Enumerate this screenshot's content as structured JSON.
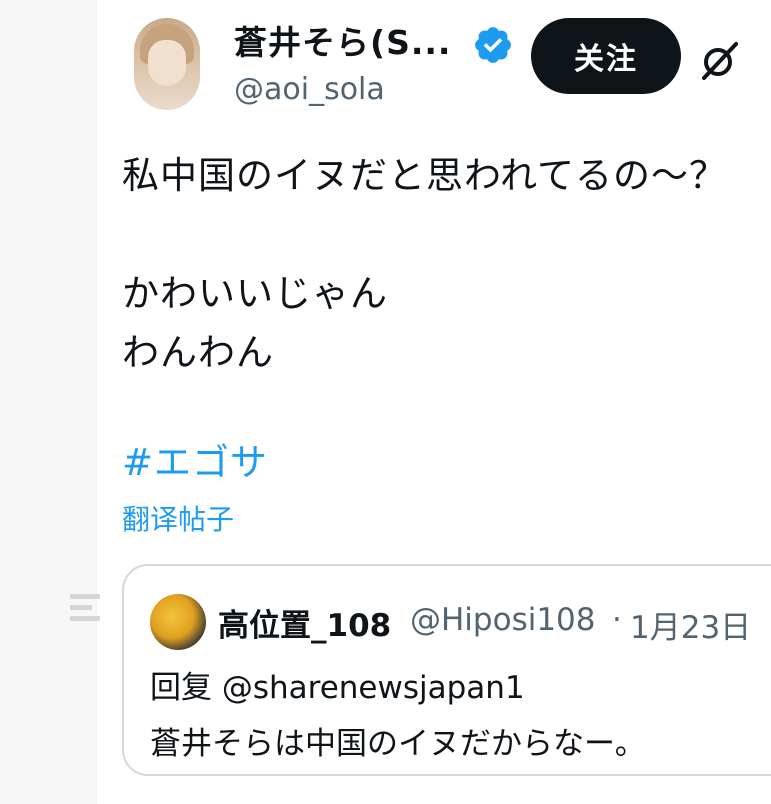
{
  "author": {
    "display_name": "蒼井そら(S...",
    "handle": "@aoi_sola",
    "verified": true
  },
  "header": {
    "follow_label": "关注"
  },
  "post": {
    "text": "私中国のイヌだと思われてるの～？\n\nかわいいじゃん\nわんわん",
    "hashtag": "#エゴサ",
    "translate_label": "翻译帖子"
  },
  "quoted_post": {
    "display_name": "高位置_108",
    "handle": "@Hiposi108",
    "separator": "·",
    "date": "1月23日",
    "reply_to": "回复 @sharenewsjapan1",
    "text": "蒼井そらは中国のイヌだからなー。"
  },
  "icons": {
    "verified": "verified-badge-icon",
    "grok": "grok-icon",
    "sidebar": "faint-menu-icon"
  },
  "colors": {
    "accent": "#1d9bf0",
    "text": "#0f1419",
    "secondary_text": "#536471",
    "button_bg": "#0f1419",
    "border": "#cfd9de"
  }
}
